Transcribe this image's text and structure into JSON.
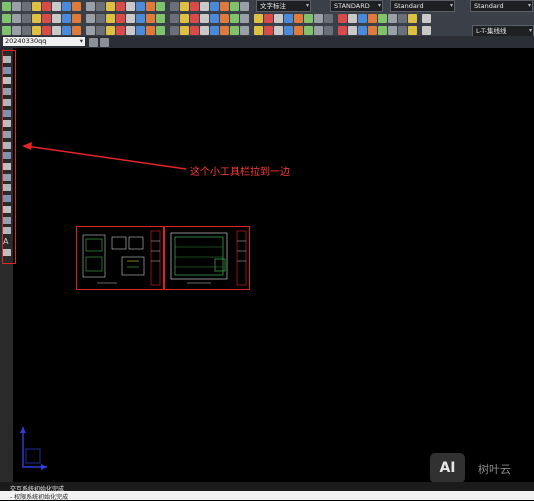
{
  "toolbar": {
    "text_style_label": "文字标注",
    "text_style_value": "STANDARD",
    "dim_style_value": "Standard",
    "table_style_value": "Standard",
    "linetype_value": "L-T-集线线"
  },
  "layer": {
    "current": "20240330qq"
  },
  "annotation": {
    "text": "这个小工具栏拉到一边",
    "color": "#ff3b3b"
  },
  "command": {
    "history_line": "交互系统初始化完成",
    "current_line": "- 权限系统初始化完成"
  },
  "watermark": {
    "badge": "AI",
    "name": "树叶云"
  },
  "colors": {
    "highlight": "#e52424",
    "canvas": "#000000",
    "drawing_border": "#d22222"
  }
}
